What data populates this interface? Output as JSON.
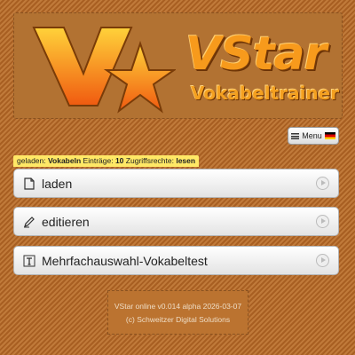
{
  "brand": {
    "title": "VStar",
    "subtitle": "Vokabeltrainer",
    "colors": {
      "orange": "#f79a1c",
      "dark": "#6a3206"
    }
  },
  "menu": {
    "label": "Menu",
    "icon": "hamburger-icon",
    "flag": "german-flag-icon"
  },
  "status": {
    "loaded_label": "geladen:",
    "loaded_value": "Vokabeln",
    "entries_label": "Einträge:",
    "entries_value": "10",
    "rights_label": "Zugriffsrechte:",
    "rights_value": "lesen",
    "color": "#ffe866"
  },
  "actions": [
    {
      "label": "laden",
      "icon": "document-icon"
    },
    {
      "label": "editieren",
      "icon": "pencil-icon"
    },
    {
      "label": "Mehrfachauswahl-Vokabeltest",
      "icon": "text-format-icon"
    }
  ],
  "footer": {
    "version": "VStar online v0.014 alpha 2026-03-07",
    "copyright": "(c) Schweitzer Digital Solutions"
  }
}
